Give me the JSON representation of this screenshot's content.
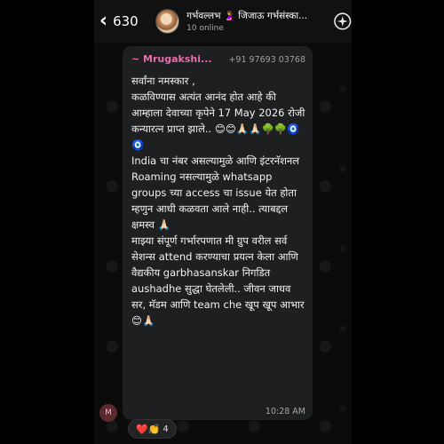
{
  "header": {
    "back_count": "630",
    "group_name": "गर्भवल्लभ 🤰 जिजाऊ गर्भसंस्का...",
    "status": "10 online"
  },
  "message": {
    "sender": "~ Mrugakshi...",
    "phone": "+91 97693 03768",
    "text": "सर्वांना नमस्कार ,\nकळविण्यास अत्यंत आनंद होत आहे की आम्हाला देवाच्या कृपेने 17 May 2026 रोजी  कन्यारत्न प्राप्त झाले.. 😊😊🙏🏻🙏🏻🌳🌳🧿🧿\nIndia चा नंबर असल्यामुळे आणि इंटरनॅशनल Roaming नसल्यामुळे whatsapp groups च्या access चा issue येत होता म्हणुन आधी कळवता आले नाही.. त्याबद्दल क्षमस्व 🙏🏻\nमाझ्या संपूर्ण गर्भारपणात मी ग्रुप वरील सर्व सेशन्स attend करण्याचा प्रयत्न केला आणि वैद्यकीय garbhasanskar निगडित aushadhe सुद्धा घेतलेली.. जीवन जाधव सर, मॅडम आणि team che खूप खूप आभार 😊🙏🏻",
    "time": "10:28 AM",
    "sender_initial": "M"
  },
  "reactions": {
    "emojis": "❤️👏",
    "count": "4"
  },
  "icons": {
    "back": "chevron-left-icon",
    "sparkle": "sparkle-icon"
  },
  "colors": {
    "sender": "#e46dac",
    "bubble": "#1e1f21"
  }
}
